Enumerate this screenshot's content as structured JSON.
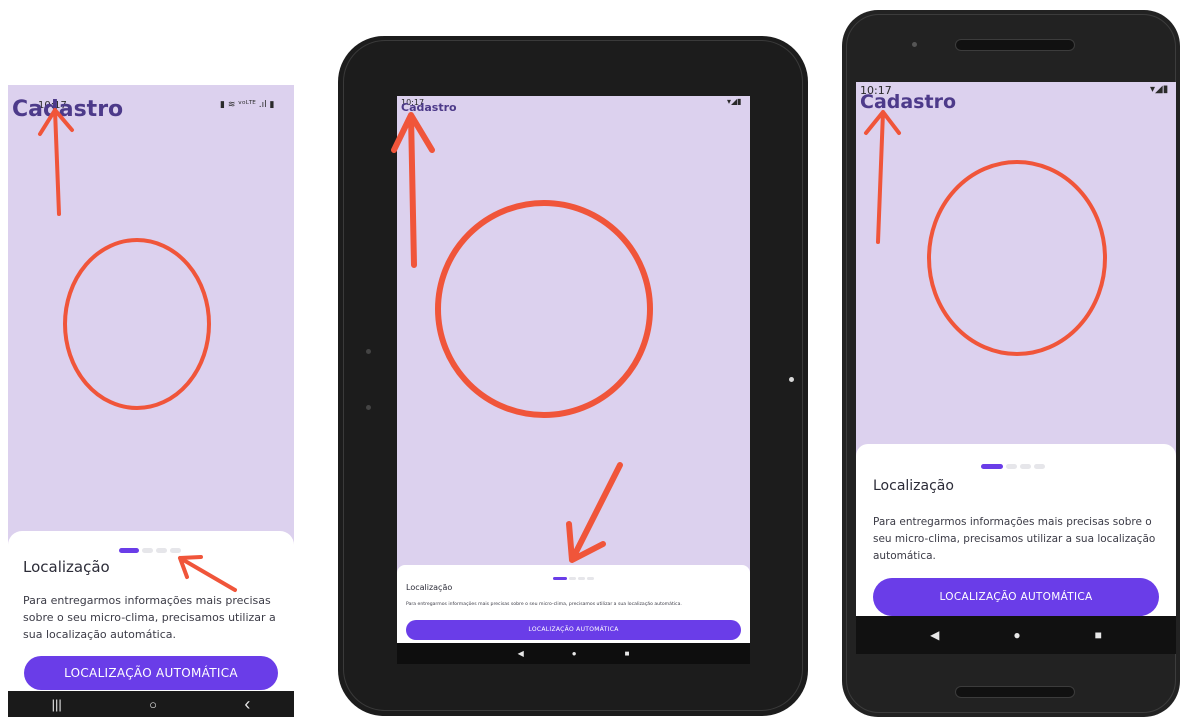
{
  "app_title": "Cadastro",
  "sheet": {
    "title": "Localização",
    "description": "Para entregarmos informações mais precisas sobre o seu micro-clima, precisamos utilizar a sua localização automática.",
    "button_label": "LOCALIZAÇÃO AUTOMÁTICA"
  },
  "pager": {
    "total_pages": 4,
    "current_page": 1
  },
  "phone_left": {
    "status_time": "10:17",
    "status_icons": "▮ ≋ ᵛᵒᴸᵀᴱ .ıl ▮",
    "nav": [
      "|||",
      "○",
      "‹"
    ]
  },
  "tablet": {
    "status_time": "10:17",
    "status_icons": "▾◢▮",
    "nav": [
      "◀",
      "●",
      "■"
    ]
  },
  "phone_right": {
    "status_time": "10:17",
    "status_icons": "▾◢▮",
    "nav": [
      "◀",
      "●",
      "■"
    ]
  },
  "colors": {
    "screen_bg": "#dcd1ee",
    "accent": "#6a3de8",
    "annotation": "#f0553a",
    "title": "#4d3a8a"
  }
}
